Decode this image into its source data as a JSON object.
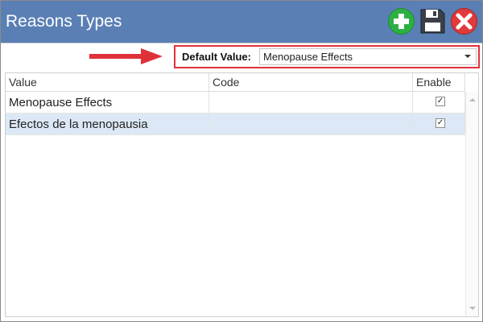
{
  "window": {
    "title": "Reasons Types",
    "buttons": [
      {
        "name": "add",
        "icon": "plus-circle-icon",
        "color": "#2db043"
      },
      {
        "name": "save",
        "icon": "floppy-disk-icon",
        "color": "#3a4048"
      },
      {
        "name": "close",
        "icon": "close-circle-icon",
        "color": "#e03a3a"
      }
    ],
    "accent": "#5a7fb5"
  },
  "default_value": {
    "label": "Default Value:",
    "selected": "Menopause Effects",
    "highlight_color": "#e0313a",
    "arrow_color": "#e0313a"
  },
  "grid": {
    "columns": [
      "Value",
      "Code",
      "Enable"
    ],
    "rows": [
      {
        "value": "Menopause Effects",
        "code": "",
        "enable": "✓",
        "selected": false
      },
      {
        "value": "Efectos de la menopausia",
        "code": "",
        "enable": "✓",
        "selected": true
      }
    ]
  }
}
